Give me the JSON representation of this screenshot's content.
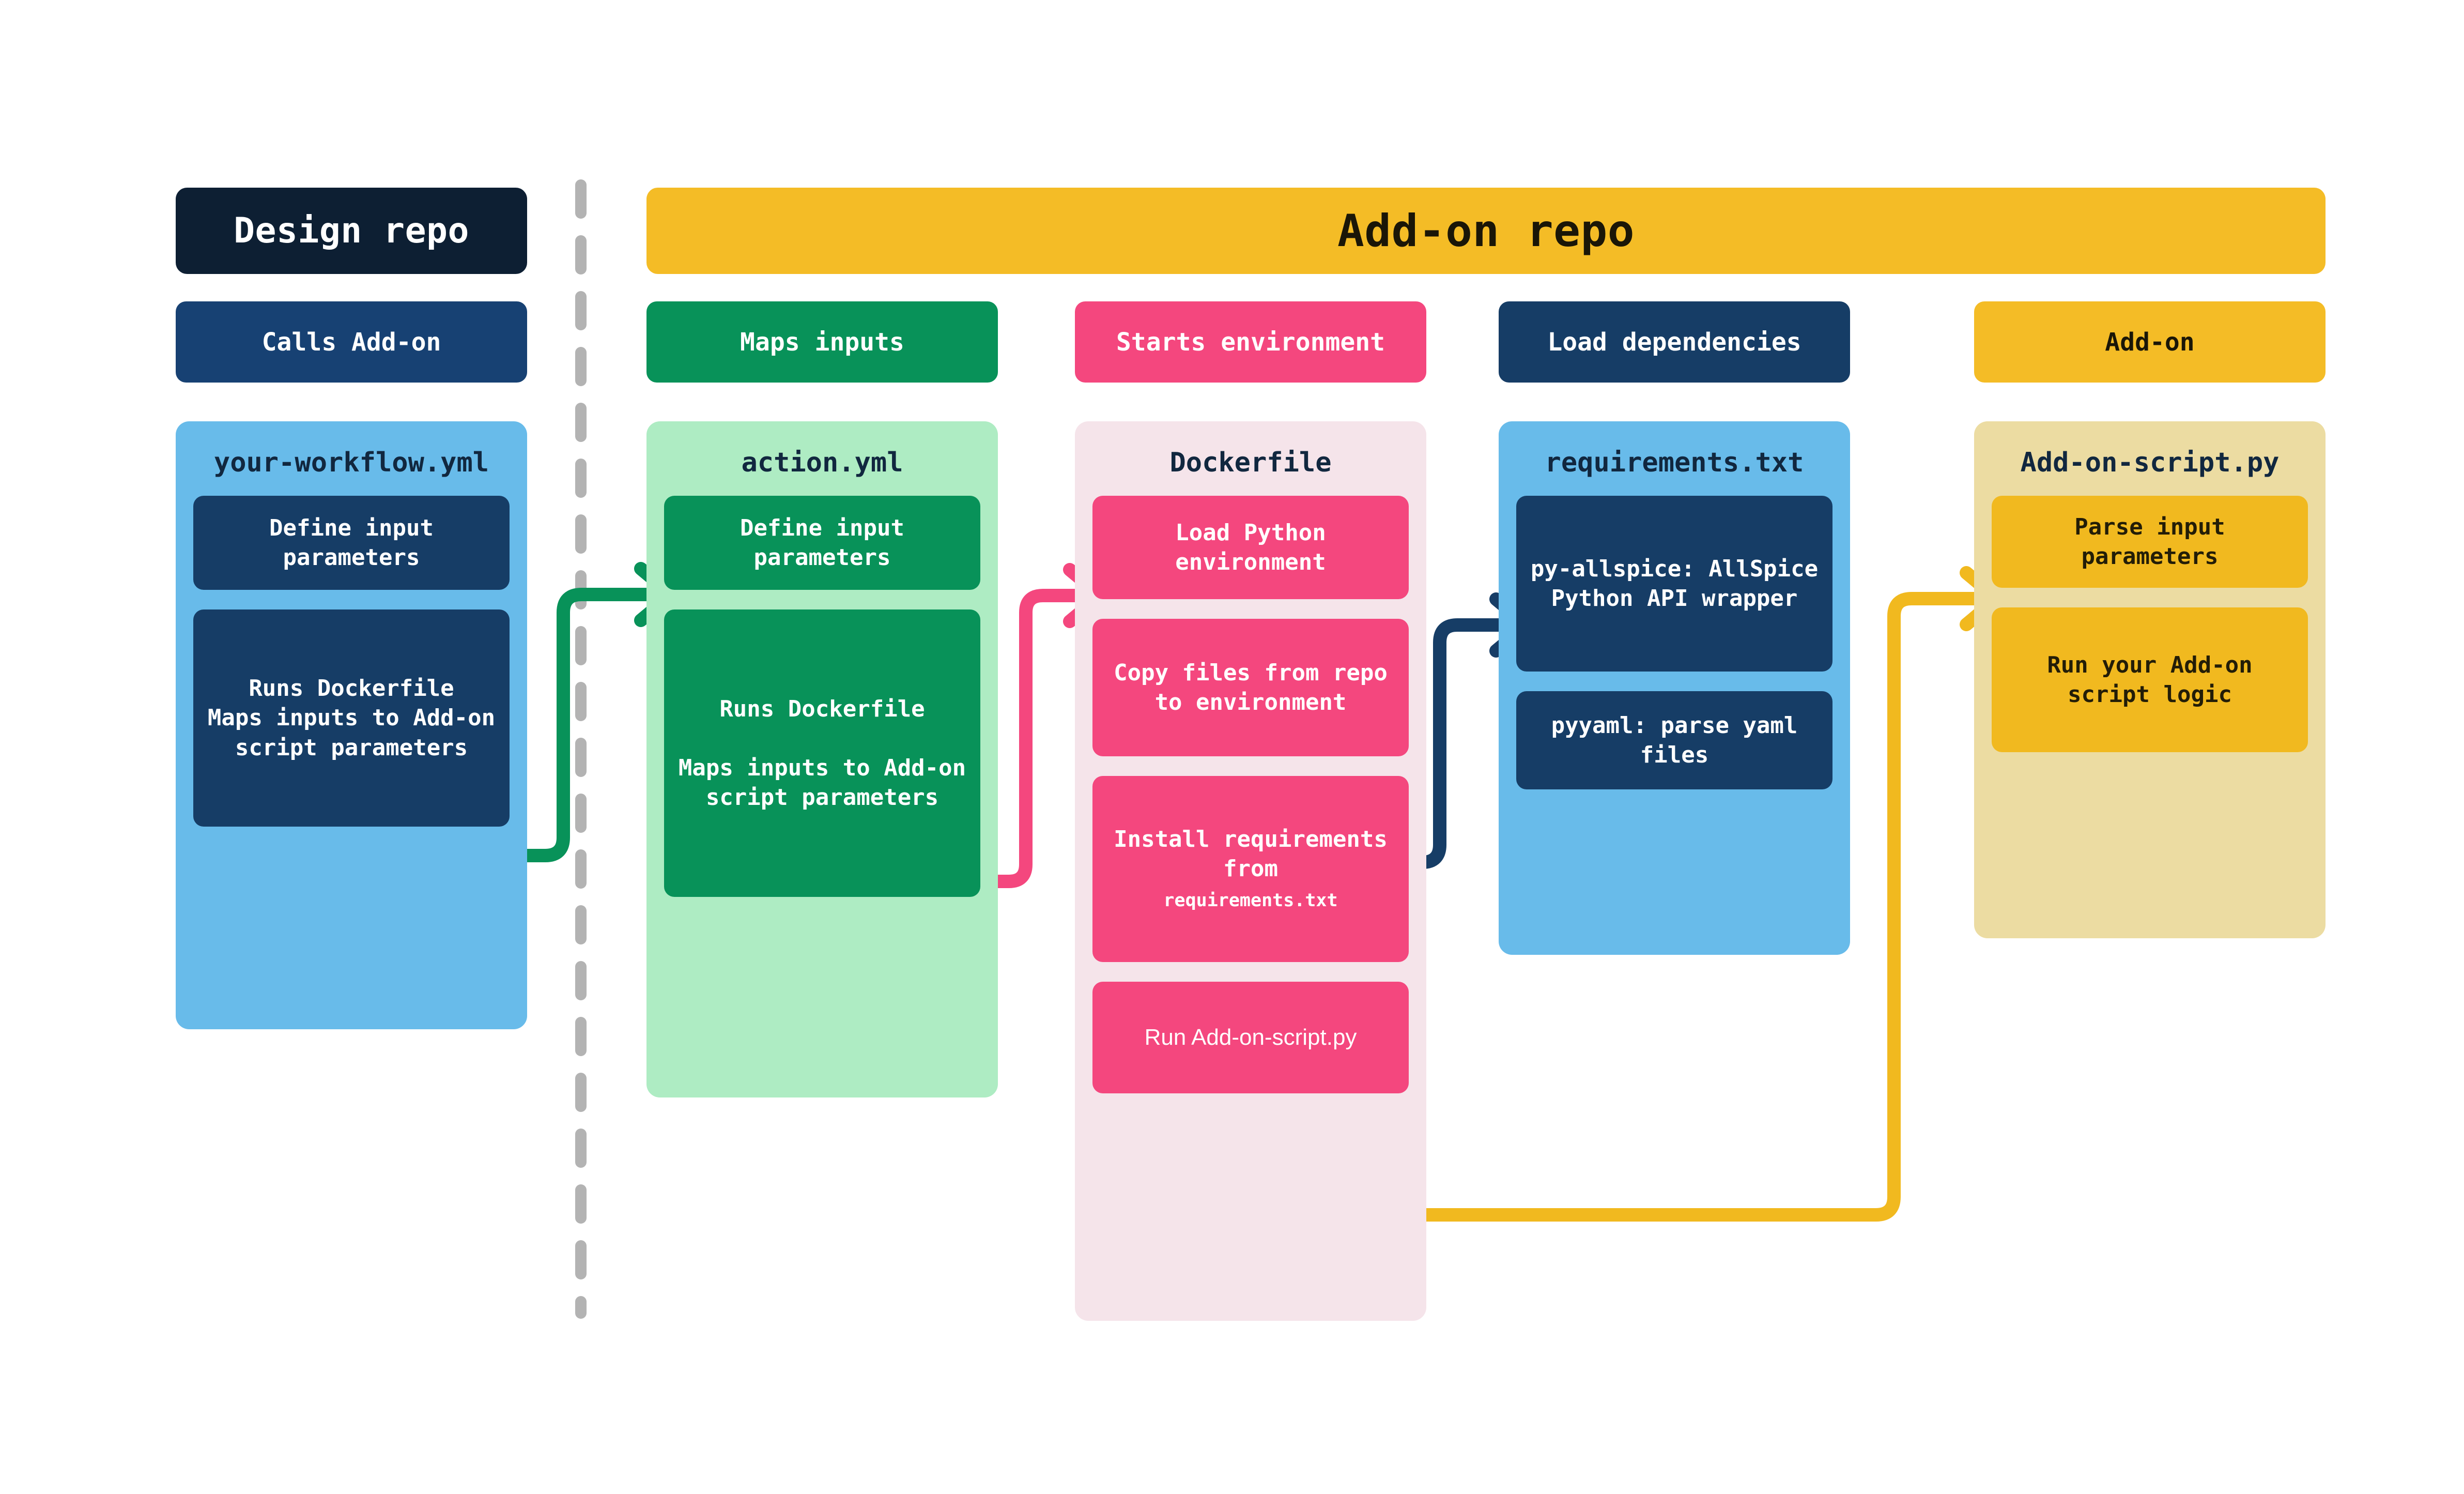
{
  "diagram": {
    "title_left": "Design repo",
    "title_right": "Add-on repo",
    "divider": "vertical-dashed-divider"
  },
  "columns": [
    {
      "key": "workflow",
      "sub_header": "Calls Add-on",
      "panel_title": "your-workflow.yml",
      "cards": [
        {
          "text": "Define input parameters"
        },
        {
          "text": "Runs Dockerfile\nMaps inputs to Add-on script parameters"
        }
      ]
    },
    {
      "key": "action",
      "sub_header": "Maps inputs",
      "panel_title": "action.yml",
      "cards": [
        {
          "text": "Define input parameters"
        },
        {
          "text": "Runs Dockerfile\n\nMaps inputs to Add-on script parameters"
        }
      ]
    },
    {
      "key": "dockerfile",
      "sub_header": "Starts environment",
      "panel_title": "Dockerfile",
      "cards": [
        {
          "text": "Load Python environment"
        },
        {
          "text": "Copy files from repo to environment"
        },
        {
          "text": "Install requirements from ",
          "small": "requirements.txt"
        },
        {
          "text": "Run Add-on-script.py"
        }
      ]
    },
    {
      "key": "requirements",
      "sub_header": "Load dependencies",
      "panel_title": "requirements.txt",
      "cards": [
        {
          "text": "py-allspice: AllSpice Python API wrapper"
        },
        {
          "text": "pyyaml: parse yaml files"
        }
      ]
    },
    {
      "key": "addon-script",
      "sub_header": "Add-on",
      "panel_title": "Add-on-script.py",
      "cards": [
        {
          "text": "Parse input parameters"
        },
        {
          "text": "Run your Add-on script logic"
        }
      ]
    }
  ],
  "arrows": [
    {
      "name": "workflow-to-action",
      "color": "#089259"
    },
    {
      "name": "action-to-dockerfile",
      "color": "#f4477e"
    },
    {
      "name": "dockerfile-to-requirements",
      "color": "#163d66"
    },
    {
      "name": "dockerfile-to-addon-script",
      "color": "#f1b91f"
    }
  ],
  "colors": {
    "navy_dark": "#0d1f33",
    "navy": "#163d66",
    "yellow": "#f4bc26",
    "gold": "#f1b91f",
    "green": "#089259",
    "green_light": "#aeecc3",
    "pink": "#f4477e",
    "pink_light": "#f5e4ea",
    "blue": "#68bbea",
    "sand": "#ecdca2",
    "divider_gray": "#b3b3b3"
  }
}
